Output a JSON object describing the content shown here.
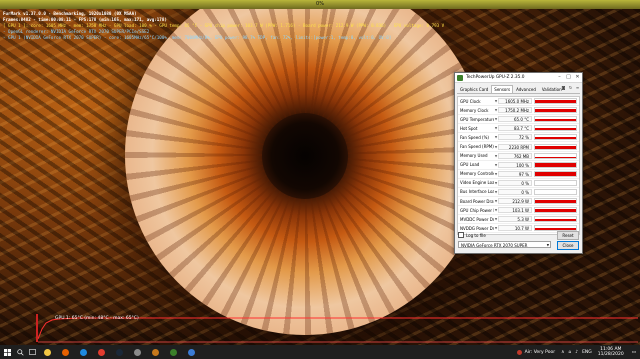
{
  "top_bar": {
    "text": "0%"
  },
  "overlay": {
    "lines": [
      {
        "text": "FurMark v1.37.0.0 - Benchmarking, 1920x1080 (0X MSAA)",
        "style": "white"
      },
      {
        "text": "Frames:8482 - time:00:08:11 - FPS:178 (min:165, max:171, avg:178)",
        "style": "white"
      },
      {
        "text": "[ GPU 1 ]: core: 1605 MHz - mem: 1750 MHz - GPU load: 100 % - GPU temp: 65 °C - GPU chip power: 103.7 W (PPW: 1.716) - Board power: 212.9 W (PPW: 0.836) - GPU voltage: 0.793 V",
        "style": "yellow"
      },
      {
        "text": "- OpenGL renderer: NVIDIA GeForce RTX 2070 SUPER/PCIe/SSE2",
        "style": "cyan"
      },
      {
        "text": "- GPU 1 (NVIDIA GeForce RTX 2070 SUPER) - core: 1605MHz/65°C/100%, mem: 7000MHz/8%, GPU power: 98.7% TDP, fan: 72%, limits:[power:1, temp:0, volt:0, OV:0]",
        "style": "cyan"
      }
    ]
  },
  "temp_graph": {
    "label": "GPU 1: 65°C (min: 48°C - max: 65°C)",
    "accent": "#ff2a2a"
  },
  "gpuz": {
    "title": "TechPowerUp GPU-Z 2.35.0",
    "tabs": [
      {
        "label": "Graphics Card",
        "active": false
      },
      {
        "label": "Sensors",
        "active": true
      },
      {
        "label": "Advanced",
        "active": false
      },
      {
        "label": "Validation",
        "active": false
      }
    ],
    "sensors": [
      {
        "label": "GPU Clock",
        "value": "1605.0 MHz",
        "level": 0.85
      },
      {
        "label": "Memory Clock",
        "value": "1750.2 MHz",
        "level": 0.85
      },
      {
        "label": "GPU Temperature",
        "value": "65.0 °C",
        "level": 0.65
      },
      {
        "label": "Hot Spot",
        "value": "83.7 °C",
        "level": 0.7
      },
      {
        "label": "Fan Speed (%)",
        "value": "72 %",
        "level": 0.72
      },
      {
        "label": "Fan Speed (RPM)",
        "value": "2230 RPM",
        "level": 0.6
      },
      {
        "label": "Memory Used",
        "value": "762 MB",
        "level": 0.1
      },
      {
        "label": "GPU Load",
        "value": "100 %",
        "level": 1.0
      },
      {
        "label": "Memory Controller Load",
        "value": "97 %",
        "level": 0.95
      },
      {
        "label": "Video Engine Load",
        "value": "0 %",
        "level": 0
      },
      {
        "label": "Bus Interface Load",
        "value": "0 %",
        "level": 0
      },
      {
        "label": "Board Power Draw",
        "value": "212.9 W",
        "level": 0.8
      },
      {
        "label": "GPU Chip Power Draw",
        "value": "103.1 W",
        "level": 0.7
      },
      {
        "label": "MVDDC Power Draw",
        "value": "5.3 W",
        "level": 0.5
      },
      {
        "label": "NVDDG Power Draw",
        "value": "10.7 W",
        "level": 0.6
      },
      {
        "label": "PWR_SRC Power Draw",
        "value": "86.9 W",
        "level": 0.55
      }
    ],
    "log_label": "Log to file",
    "reset_label": "Reset",
    "gpu_select": "NVIDIA GeForce RTX 2070 SUPER",
    "close_label": "Close"
  },
  "taskbar": {
    "icons": [
      "file-explorer-icon",
      "firefox-icon",
      "edge-icon",
      "chrome-icon",
      "steam-icon",
      "settings-icon",
      "furmark-icon",
      "gpuz-icon",
      "mail-icon"
    ],
    "air_quality": "Air: Very Poor",
    "lang": "ENG",
    "time": "11:06 AM",
    "date": "11/28/2020"
  }
}
